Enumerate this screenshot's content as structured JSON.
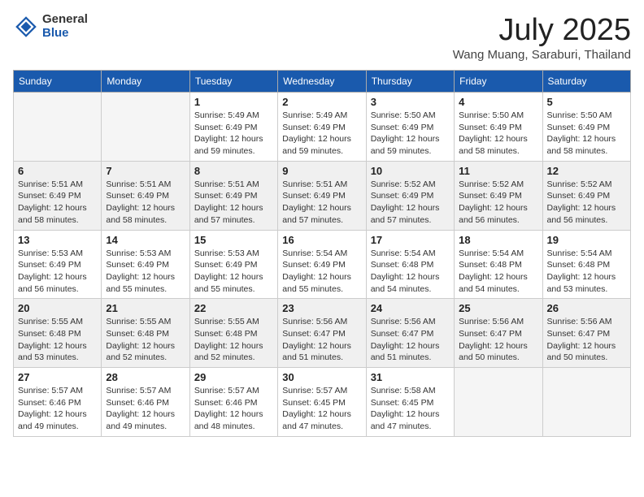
{
  "header": {
    "logo_general": "General",
    "logo_blue": "Blue",
    "month_title": "July 2025",
    "location": "Wang Muang, Saraburi, Thailand"
  },
  "weekdays": [
    "Sunday",
    "Monday",
    "Tuesday",
    "Wednesday",
    "Thursday",
    "Friday",
    "Saturday"
  ],
  "weeks": [
    [
      {
        "day": "",
        "info": ""
      },
      {
        "day": "",
        "info": ""
      },
      {
        "day": "1",
        "info": "Sunrise: 5:49 AM\nSunset: 6:49 PM\nDaylight: 12 hours and 59 minutes."
      },
      {
        "day": "2",
        "info": "Sunrise: 5:49 AM\nSunset: 6:49 PM\nDaylight: 12 hours and 59 minutes."
      },
      {
        "day": "3",
        "info": "Sunrise: 5:50 AM\nSunset: 6:49 PM\nDaylight: 12 hours and 59 minutes."
      },
      {
        "day": "4",
        "info": "Sunrise: 5:50 AM\nSunset: 6:49 PM\nDaylight: 12 hours and 58 minutes."
      },
      {
        "day": "5",
        "info": "Sunrise: 5:50 AM\nSunset: 6:49 PM\nDaylight: 12 hours and 58 minutes."
      }
    ],
    [
      {
        "day": "6",
        "info": "Sunrise: 5:51 AM\nSunset: 6:49 PM\nDaylight: 12 hours and 58 minutes."
      },
      {
        "day": "7",
        "info": "Sunrise: 5:51 AM\nSunset: 6:49 PM\nDaylight: 12 hours and 58 minutes."
      },
      {
        "day": "8",
        "info": "Sunrise: 5:51 AM\nSunset: 6:49 PM\nDaylight: 12 hours and 57 minutes."
      },
      {
        "day": "9",
        "info": "Sunrise: 5:51 AM\nSunset: 6:49 PM\nDaylight: 12 hours and 57 minutes."
      },
      {
        "day": "10",
        "info": "Sunrise: 5:52 AM\nSunset: 6:49 PM\nDaylight: 12 hours and 57 minutes."
      },
      {
        "day": "11",
        "info": "Sunrise: 5:52 AM\nSunset: 6:49 PM\nDaylight: 12 hours and 56 minutes."
      },
      {
        "day": "12",
        "info": "Sunrise: 5:52 AM\nSunset: 6:49 PM\nDaylight: 12 hours and 56 minutes."
      }
    ],
    [
      {
        "day": "13",
        "info": "Sunrise: 5:53 AM\nSunset: 6:49 PM\nDaylight: 12 hours and 56 minutes."
      },
      {
        "day": "14",
        "info": "Sunrise: 5:53 AM\nSunset: 6:49 PM\nDaylight: 12 hours and 55 minutes."
      },
      {
        "day": "15",
        "info": "Sunrise: 5:53 AM\nSunset: 6:49 PM\nDaylight: 12 hours and 55 minutes."
      },
      {
        "day": "16",
        "info": "Sunrise: 5:54 AM\nSunset: 6:49 PM\nDaylight: 12 hours and 55 minutes."
      },
      {
        "day": "17",
        "info": "Sunrise: 5:54 AM\nSunset: 6:48 PM\nDaylight: 12 hours and 54 minutes."
      },
      {
        "day": "18",
        "info": "Sunrise: 5:54 AM\nSunset: 6:48 PM\nDaylight: 12 hours and 54 minutes."
      },
      {
        "day": "19",
        "info": "Sunrise: 5:54 AM\nSunset: 6:48 PM\nDaylight: 12 hours and 53 minutes."
      }
    ],
    [
      {
        "day": "20",
        "info": "Sunrise: 5:55 AM\nSunset: 6:48 PM\nDaylight: 12 hours and 53 minutes."
      },
      {
        "day": "21",
        "info": "Sunrise: 5:55 AM\nSunset: 6:48 PM\nDaylight: 12 hours and 52 minutes."
      },
      {
        "day": "22",
        "info": "Sunrise: 5:55 AM\nSunset: 6:48 PM\nDaylight: 12 hours and 52 minutes."
      },
      {
        "day": "23",
        "info": "Sunrise: 5:56 AM\nSunset: 6:47 PM\nDaylight: 12 hours and 51 minutes."
      },
      {
        "day": "24",
        "info": "Sunrise: 5:56 AM\nSunset: 6:47 PM\nDaylight: 12 hours and 51 minutes."
      },
      {
        "day": "25",
        "info": "Sunrise: 5:56 AM\nSunset: 6:47 PM\nDaylight: 12 hours and 50 minutes."
      },
      {
        "day": "26",
        "info": "Sunrise: 5:56 AM\nSunset: 6:47 PM\nDaylight: 12 hours and 50 minutes."
      }
    ],
    [
      {
        "day": "27",
        "info": "Sunrise: 5:57 AM\nSunset: 6:46 PM\nDaylight: 12 hours and 49 minutes."
      },
      {
        "day": "28",
        "info": "Sunrise: 5:57 AM\nSunset: 6:46 PM\nDaylight: 12 hours and 49 minutes."
      },
      {
        "day": "29",
        "info": "Sunrise: 5:57 AM\nSunset: 6:46 PM\nDaylight: 12 hours and 48 minutes."
      },
      {
        "day": "30",
        "info": "Sunrise: 5:57 AM\nSunset: 6:45 PM\nDaylight: 12 hours and 47 minutes."
      },
      {
        "day": "31",
        "info": "Sunrise: 5:58 AM\nSunset: 6:45 PM\nDaylight: 12 hours and 47 minutes."
      },
      {
        "day": "",
        "info": ""
      },
      {
        "day": "",
        "info": ""
      }
    ]
  ]
}
